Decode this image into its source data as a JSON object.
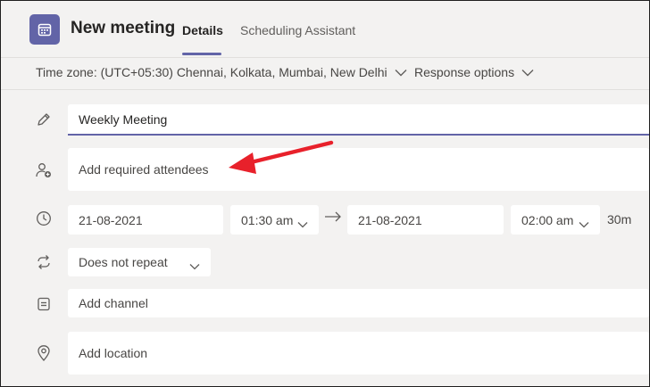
{
  "header": {
    "title": "New meeting",
    "tabs": [
      {
        "label": "Details",
        "active": true
      },
      {
        "label": "Scheduling Assistant",
        "active": false
      }
    ]
  },
  "subbar": {
    "timezone": "Time zone: (UTC+05:30) Chennai, Kolkata, Mumbai, New Delhi",
    "response_options": "Response options"
  },
  "form": {
    "title_value": "Weekly Meeting",
    "attendees_placeholder": "Add required attendees",
    "start_date": "21-08-2021",
    "start_time": "01:30 am",
    "end_date": "21-08-2021",
    "end_time": "02:00 am",
    "duration": "30m",
    "repeat": "Does not repeat",
    "channel_placeholder": "Add channel",
    "location_placeholder": "Add location"
  },
  "colors": {
    "accent": "#6264a7",
    "annotation_arrow": "#e8212b"
  },
  "icons": [
    "calendar-icon",
    "pencil-icon",
    "add-person-icon",
    "clock-icon",
    "repeat-icon",
    "channel-icon",
    "location-pin-icon",
    "chevron-down-icon",
    "right-arrow-icon"
  ]
}
